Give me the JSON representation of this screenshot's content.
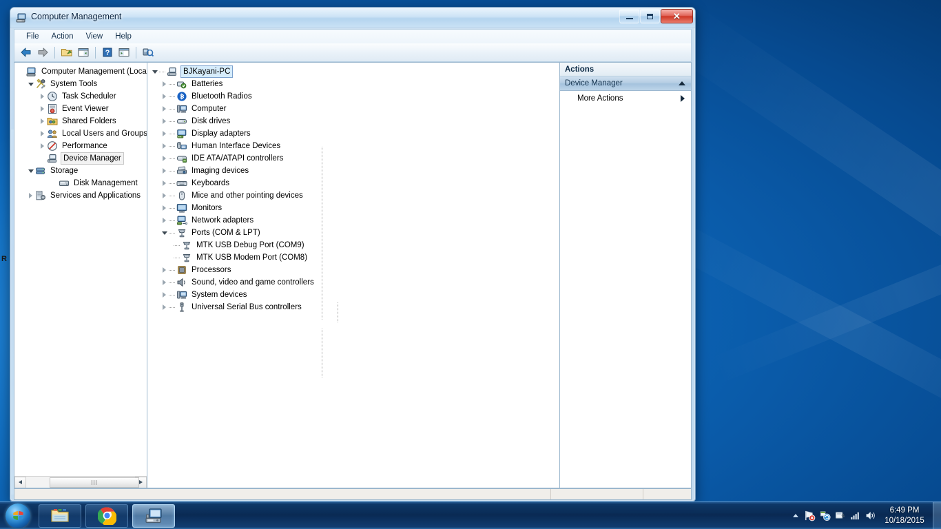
{
  "window": {
    "title": "Computer Management",
    "icon": "computer-management-icon",
    "buttons": {
      "minimize": "Minimize",
      "maximize": "Maximize",
      "close": "Close"
    }
  },
  "menubar": {
    "items": [
      {
        "label": "File"
      },
      {
        "label": "Action"
      },
      {
        "label": "View"
      },
      {
        "label": "Help"
      }
    ]
  },
  "toolbar": {
    "buttons": [
      {
        "name": "back-button",
        "icon": "back-arrow-icon"
      },
      {
        "name": "forward-button",
        "icon": "forward-arrow-icon"
      },
      {
        "name": "up-one-level-button",
        "icon": "folder-up-icon"
      },
      {
        "name": "show-hide-console-tree-button",
        "icon": "console-tree-icon"
      },
      {
        "name": "help-button",
        "icon": "question-mark-icon"
      },
      {
        "name": "show-hide-action-pane-button",
        "icon": "action-pane-icon"
      },
      {
        "name": "scan-for-hardware-changes-button",
        "icon": "scan-hardware-icon"
      }
    ]
  },
  "console_tree": {
    "root": {
      "label": "Computer Management (Local",
      "icon": "computer-icon",
      "expanded": true
    },
    "nodes": [
      {
        "label": "System Tools",
        "icon": "system-tools-icon",
        "level": 1,
        "state": "expanded"
      },
      {
        "label": "Task Scheduler",
        "icon": "clock-icon",
        "level": 2,
        "state": "collapsed"
      },
      {
        "label": "Event Viewer",
        "icon": "event-viewer-icon",
        "level": 2,
        "state": "collapsed"
      },
      {
        "label": "Shared Folders",
        "icon": "shared-folders-icon",
        "level": 2,
        "state": "collapsed"
      },
      {
        "label": "Local Users and Groups",
        "icon": "users-icon",
        "level": 2,
        "state": "collapsed"
      },
      {
        "label": "Performance",
        "icon": "performance-icon",
        "level": 2,
        "state": "collapsed"
      },
      {
        "label": "Device Manager",
        "icon": "device-manager-icon",
        "level": 2,
        "state": "selected"
      },
      {
        "label": "Storage",
        "icon": "storage-icon",
        "level": 1,
        "state": "expanded"
      },
      {
        "label": "Disk Management",
        "icon": "disk-management-icon",
        "level": 2,
        "state": "leaf"
      },
      {
        "label": "Services and Applications",
        "icon": "services-icon",
        "level": 1,
        "state": "collapsed"
      }
    ]
  },
  "device_tree": {
    "root": {
      "label": "BJKayani-PC",
      "icon": "computer-node-icon",
      "state": "expanded-focused"
    },
    "nodes": [
      {
        "label": "Batteries",
        "icon": "battery-icon",
        "level": 1,
        "state": "collapsed"
      },
      {
        "label": "Bluetooth Radios",
        "icon": "bluetooth-icon",
        "level": 1,
        "state": "collapsed"
      },
      {
        "label": "Computer",
        "icon": "computer-device-icon",
        "level": 1,
        "state": "collapsed"
      },
      {
        "label": "Disk drives",
        "icon": "disk-drive-icon",
        "level": 1,
        "state": "collapsed"
      },
      {
        "label": "Display adapters",
        "icon": "display-adapter-icon",
        "level": 1,
        "state": "collapsed"
      },
      {
        "label": "Human Interface Devices",
        "icon": "hid-icon",
        "level": 1,
        "state": "collapsed"
      },
      {
        "label": "IDE ATA/ATAPI controllers",
        "icon": "ide-controller-icon",
        "level": 1,
        "state": "collapsed"
      },
      {
        "label": "Imaging devices",
        "icon": "imaging-device-icon",
        "level": 1,
        "state": "collapsed"
      },
      {
        "label": "Keyboards",
        "icon": "keyboard-icon",
        "level": 1,
        "state": "collapsed"
      },
      {
        "label": "Mice and other pointing devices",
        "icon": "mouse-icon",
        "level": 1,
        "state": "collapsed"
      },
      {
        "label": "Monitors",
        "icon": "monitor-icon",
        "level": 1,
        "state": "collapsed"
      },
      {
        "label": "Network adapters",
        "icon": "network-adapter-icon",
        "level": 1,
        "state": "collapsed"
      },
      {
        "label": "Ports (COM & LPT)",
        "icon": "port-icon",
        "level": 1,
        "state": "expanded"
      },
      {
        "label": "MTK USB Debug Port (COM9)",
        "icon": "port-icon",
        "level": 2,
        "state": "leaf"
      },
      {
        "label": "MTK USB Modem Port (COM8)",
        "icon": "port-icon",
        "level": 2,
        "state": "leaf"
      },
      {
        "label": "Processors",
        "icon": "processor-icon",
        "level": 1,
        "state": "collapsed"
      },
      {
        "label": "Sound, video and game controllers",
        "icon": "sound-icon",
        "level": 1,
        "state": "collapsed"
      },
      {
        "label": "System devices",
        "icon": "system-device-icon",
        "level": 1,
        "state": "collapsed"
      },
      {
        "label": "Universal Serial Bus controllers",
        "icon": "usb-icon",
        "level": 1,
        "state": "collapsed"
      }
    ]
  },
  "actions_pane": {
    "header": "Actions",
    "section": {
      "label": "Device Manager",
      "collapse_icon": "collapse-up-icon"
    },
    "items": [
      {
        "label": "More Actions",
        "submenu_icon": "submenu-arrow-icon"
      }
    ]
  },
  "statusbar": {
    "cells": [
      "",
      "",
      ""
    ]
  },
  "taskbar": {
    "start": "start-orb",
    "tasks": [
      {
        "name": "windows-explorer-taskbar-button",
        "icon": "folder-icon",
        "active": false
      },
      {
        "name": "google-chrome-taskbar-button",
        "icon": "chrome-icon",
        "active": false
      },
      {
        "name": "computer-management-taskbar-button",
        "icon": "computer-management-icon",
        "active": true
      }
    ],
    "tray": [
      {
        "name": "tray-network-icon",
        "icon": "network-error-icon"
      },
      {
        "name": "tray-action-center-icon",
        "icon": "flag-sync-icon"
      },
      {
        "name": "tray-safely-remove-icon",
        "icon": "eject-hardware-icon"
      },
      {
        "name": "tray-signal-icon",
        "icon": "signal-bars-icon"
      },
      {
        "name": "tray-volume-icon",
        "icon": "speaker-icon"
      }
    ],
    "clock": {
      "time": "6:49 PM",
      "date": "10/18/2015"
    }
  },
  "background_window": {
    "glyph": "R"
  },
  "colors": {
    "accent": "#0d6cc0",
    "close_button": "#cf3826",
    "selection_focus": "#d6ecfb",
    "taskbar": "#0a2850"
  }
}
